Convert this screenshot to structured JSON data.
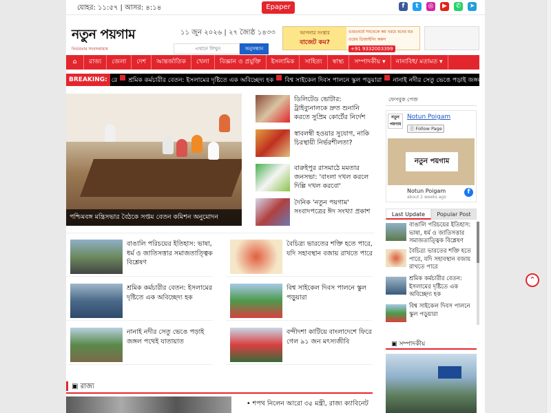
{
  "topbar": {
    "prayer_times": "যোহর: ১১:৫৭ | আসর: ৪:১৪",
    "epaper_label": "Epaper",
    "social_icons": [
      "facebook-icon",
      "twitter-icon",
      "instagram-icon",
      "youtube-icon",
      "whatsapp-icon",
      "telegram-icon"
    ]
  },
  "header": {
    "logo_text": "নতুন পয়গাম",
    "logo_tagline": "নির্ভরতার সংবাদমাধ্যম",
    "date": "১১ জুন ২০২৬ | ২৭ জ্যৈষ্ঠ ১৪৩৩",
    "search_placeholder": "এখানে লিখুন",
    "search_button": "অনুসন্ধান",
    "ad": {
      "left_line1": "আপনার সংস্থার",
      "left_line2": "বাজেট কম?",
      "right_text": "ভারতবর্ষে সবথেকে কম খরচে মনের মত ওয়েব ডিজাইনিং করুন",
      "phone": "+91 9332003399"
    }
  },
  "nav": {
    "items": [
      "রাজ্য",
      "জেলা",
      "দেশ",
      "আন্তর্জাতিক",
      "খেলা",
      "বিজ্ঞান ও প্রযুক্তি",
      "ইসলামিক",
      "সাহিত্য",
      "স্বাস্থ্য",
      "সম্পাদকীয় ▾",
      "নানাবিধ/ মতামত ▾"
    ]
  },
  "breaking": {
    "label": "BREAKING:",
    "items": [
      "রে",
      "শ্রমিক কর্মচারীর বেতন: ইসলামের দৃষ্টিতে এক অবিচ্ছেদ্য হক",
      "বিশ্ব সাইকেল দিবস পালনে স্কুল পড়ুয়ারা",
      "নানাই নদীর সেতু ভেঙে পড়াই জঙ্গল পথেই যাতায়াত"
    ]
  },
  "lead": {
    "caption": "পশ্চিমবঙ্গ মন্ত্রিসভার বৈঠকে সপ্তম বেতন কমিশন অনুমোদন"
  },
  "side_list": [
    {
      "title": "ডিলিটেড ভোটার: ট্রাইব্যুনালকে দ্রুত শুনানি করতে সুপ্রিম কোর্টের নির্দেশ"
    },
    {
      "title": "স্বাবলম্বী হওয়ার সুযোগ, নাকি চিরস্থায়ী নির্ভরশীলতা?"
    },
    {
      "title": "বারুইপুর রাসমাঠে মমতার জনসভা: 'বাংলা দখল করলে দিল্লি দখল করবো'"
    },
    {
      "title": "দৈনিক 'নতুন পয়গাম' সংবাদপত্রের ঈদ সংখ্যা প্রকাশ"
    }
  ],
  "grid": [
    {
      "title": "বাঙালি পরিচয়ের ইতিহাস: ভাষা, ধর্ম ও জাতিসত্তার সমাজতাত্ত্বিক বিশ্লেষণ"
    },
    {
      "title": "বৈচিত্র্য ভারতের শক্তি হতে পারে, যদি সহাবস্থান বজায় রাখতে পারে"
    },
    {
      "title": "শ্রমিক কর্মচারীর বেতন: ইসলামের দৃষ্টিতে এক অবিচ্ছেদ্য হক"
    },
    {
      "title": "বিশ্ব সাইকেল দিবস পালনে স্কুল পড়ুয়ারা"
    },
    {
      "title": "নানাই নদীর সেতু ভেঙে পড়াই জঙ্গল পথেই যাতায়াত"
    },
    {
      "title": "বন্দীদশা কাটিয়ে বাংলাদেশে ফিরে গেল ৯১ জন মৎস্যজীবি"
    }
  ],
  "rajya": {
    "section_title": "রাজ্য",
    "first_title": "শপথ নিলেন আরো ৩৫ মন্ত্রী, রাজ্য ক্যাবিনেট"
  },
  "sidebar": {
    "fb_heading": "ফেসবুক পেজ",
    "fb_page_name": "Notun Poigam",
    "fb_follow": "Follow Page",
    "fb_cover_text": "নতুন পয়গাম",
    "fb_post_name": "Notun Poigam",
    "fb_post_time": "about 2 weeks ago",
    "tabs": [
      "Last Update",
      "Popular Post"
    ],
    "latest": [
      "বাঙালি পরিচয়ের ইতিহাস: ভাষা, ধর্ম ও জাতিসত্তার সমাজতাত্ত্বিক বিশ্লেষণ",
      "বৈচিত্র্য ভারতের শক্তি হতে পারে, যদি সহাবস্থান বজায় রাখতে পারে",
      "শ্রমিক কর্মচারীর বেতন: ইসলামের দৃষ্টিতে এক অবিচ্ছেদ্য হক",
      "বিশ্ব সাইকেল দিবস পালনে স্কুল পড়ুয়ারা"
    ],
    "editorial_heading": "সম্পাদকীয়"
  }
}
